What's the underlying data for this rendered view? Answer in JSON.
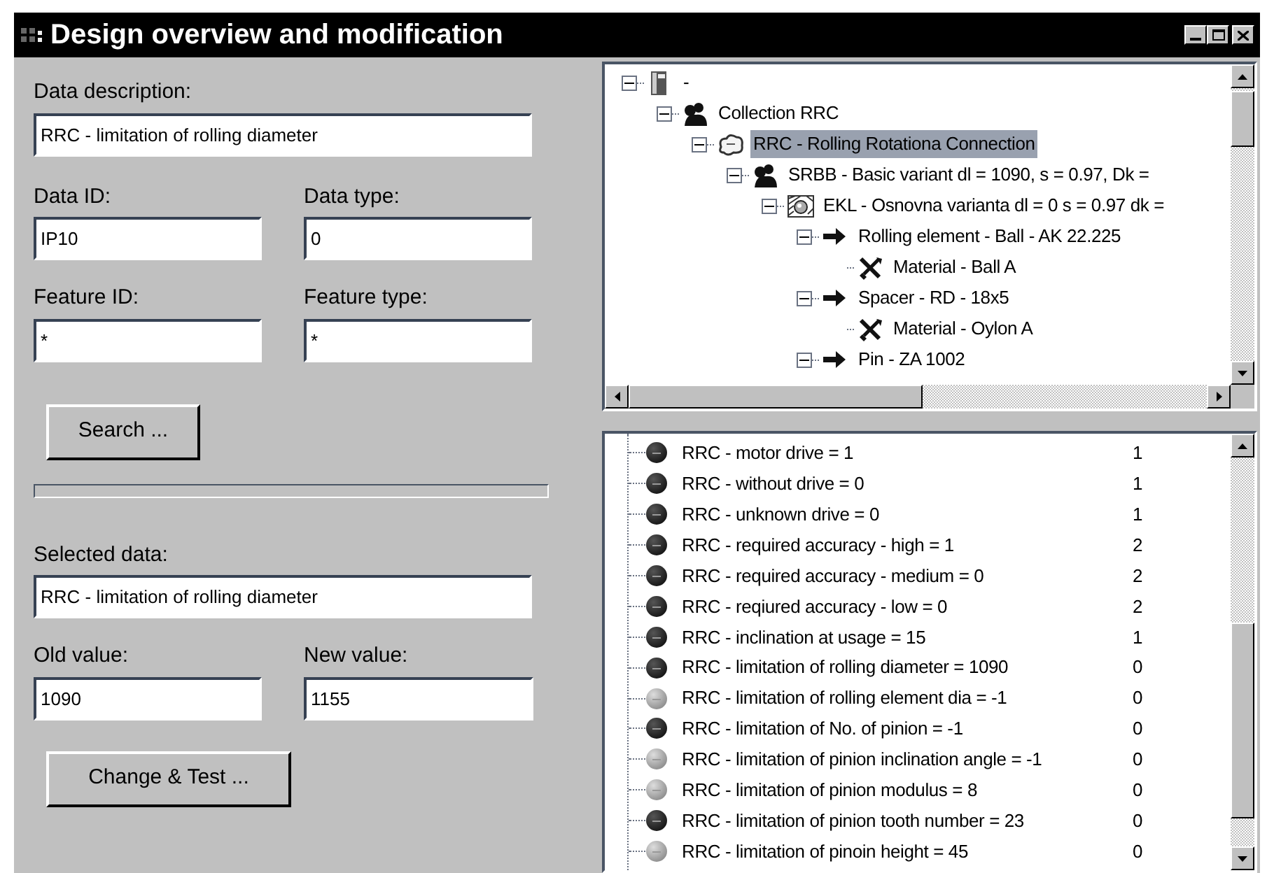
{
  "window": {
    "title": "Design overview and modification"
  },
  "form": {
    "data_description": {
      "label": "Data description:",
      "value": "RRC - limitation of rolling diameter"
    },
    "data_id": {
      "label": "Data ID:",
      "value": "IP10"
    },
    "data_type": {
      "label": "Data type:",
      "value": "0"
    },
    "feature_id": {
      "label": "Feature ID:",
      "value": "*"
    },
    "feature_type": {
      "label": "Feature type:",
      "value": "*"
    },
    "search_button": "Search ...",
    "progress": {
      "level": 0
    },
    "selected_data": {
      "label": "Selected data:",
      "value": "RRC - limitation of rolling diameter"
    },
    "old_value": {
      "label": "Old value:",
      "value": "1090"
    },
    "new_value": {
      "label": "New value:",
      "value": "1155"
    },
    "change_button": "Change & Test ..."
  },
  "tree": {
    "items": [
      {
        "label": "-",
        "kind": "book",
        "expanded": true,
        "selected": false,
        "children": [
          {
            "label": "Collection RRC",
            "kind": "group",
            "expanded": true,
            "selected": false,
            "children": [
              {
                "label": "RRC - Rolling Rotationa Connection",
                "kind": "cloud",
                "expanded": true,
                "selected": true,
                "children": [
                  {
                    "label": "SRBB - Basic variant dl = 1090, s = 0.97, Dk =",
                    "kind": "group",
                    "expanded": true,
                    "selected": false,
                    "children": [
                      {
                        "label": "EKL - Osnovna varianta  dl = 0 s = 0.97 dk =",
                        "kind": "bearing",
                        "expanded": true,
                        "selected": false,
                        "children": [
                          {
                            "label": "Rolling element - Ball - AK 22.225",
                            "kind": "part",
                            "expanded": true,
                            "selected": false,
                            "children": [
                              {
                                "label": "Material - Ball A",
                                "kind": "material",
                                "selected": false
                              }
                            ]
                          },
                          {
                            "label": "Spacer - RD - 18x5",
                            "kind": "part",
                            "expanded": true,
                            "selected": false,
                            "children": [
                              {
                                "label": "Material - Oylon A",
                                "kind": "material",
                                "selected": false
                              }
                            ]
                          },
                          {
                            "label": "Pin - ZA 1002",
                            "kind": "part",
                            "expanded": true,
                            "selected": false
                          }
                        ]
                      }
                    ]
                  }
                ]
              }
            ]
          }
        ]
      }
    ]
  },
  "list": {
    "rows": [
      {
        "label": "RRC - motor drive = 1",
        "value": "1",
        "kind": "dark"
      },
      {
        "label": "RRC - without drive = 0",
        "value": "1",
        "kind": "dark"
      },
      {
        "label": "RRC - unknown drive = 0",
        "value": "1",
        "kind": "dark"
      },
      {
        "label": "RRC - required accuracy - high = 1",
        "value": "2",
        "kind": "dark"
      },
      {
        "label": "RRC - required accuracy - medium = 0",
        "value": "2",
        "kind": "dark"
      },
      {
        "label": "RRC - reqiured accuracy - low = 0",
        "value": "2",
        "kind": "dark"
      },
      {
        "label": "RRC - inclination at usage = 15",
        "value": "1",
        "kind": "dark"
      },
      {
        "label": "RRC - limitation of rolling diameter = 1090",
        "value": "0",
        "kind": "dark"
      },
      {
        "label": "RRC - limitation of rolling element dia = -1",
        "value": "0",
        "kind": "light"
      },
      {
        "label": "RRC - limitation of No. of pinion = -1",
        "value": "0",
        "kind": "dark"
      },
      {
        "label": "RRC - limitation of pinion inclination angle = -1",
        "value": "0",
        "kind": "light"
      },
      {
        "label": "RRC - limitation of pinion modulus = 8",
        "value": "0",
        "kind": "light"
      },
      {
        "label": "RRC - limitation of pinion tooth number = 23",
        "value": "0",
        "kind": "dark"
      },
      {
        "label": "RRC - limitation of pinoin height = 45",
        "value": "0",
        "kind": "light"
      }
    ]
  }
}
